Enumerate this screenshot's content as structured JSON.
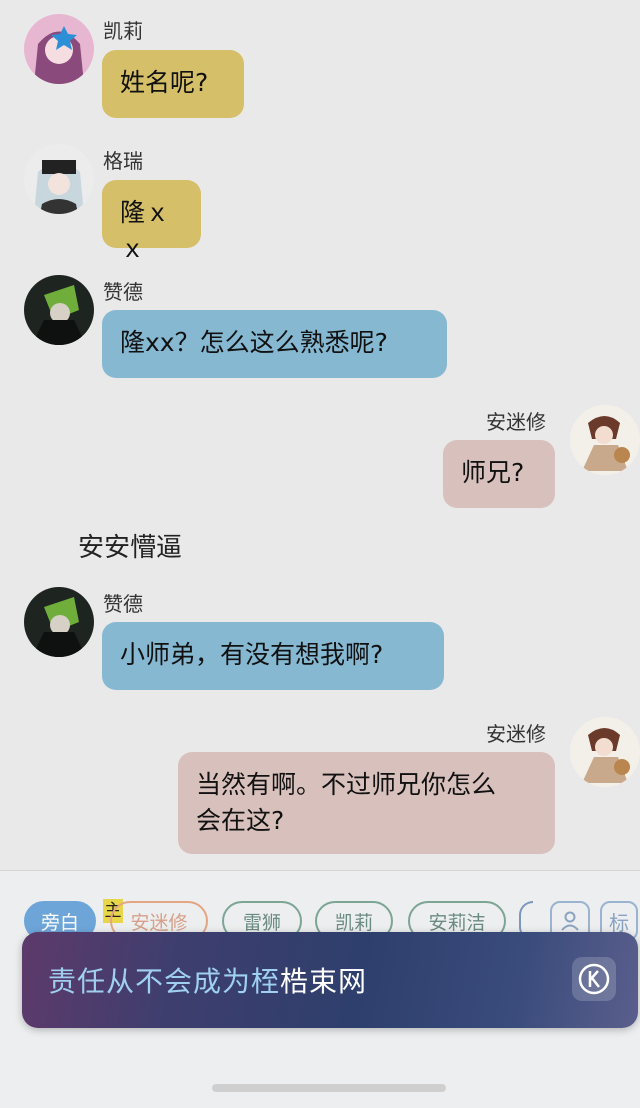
{
  "messages": [
    {
      "speaker": "凯莉",
      "text": "姓名呢?"
    },
    {
      "speaker": "格瑞",
      "text": "隆ｘｘ"
    },
    {
      "speaker": "赞德",
      "text": "隆xx？怎么这么熟悉呢?"
    },
    {
      "speaker": "安迷修",
      "text": "师兄?"
    },
    {
      "speaker": "赞德",
      "text": "小师弟，有没有想我啊?"
    },
    {
      "speaker": "安迷修",
      "text_line1": "当然有啊。不过师兄你怎么",
      "text_line2": "会在这?"
    }
  ],
  "narration": "安安懵逼",
  "character_bar": {
    "narrator": "旁白",
    "main_marker": "主",
    "chips": [
      "安迷修",
      "雷狮",
      "凯莉",
      "安莉洁"
    ],
    "person_icon": "person-icon",
    "tag_label": "标"
  },
  "banner": {
    "highlight": "责任从不会成为桎",
    "rest": "梏束网",
    "icon": "k-circle-icon"
  },
  "colors": {
    "yellow_bubble": "#d5bf68",
    "blue_bubble": "#86b8d2",
    "pink_bubble": "#d8c1bd",
    "active_chip": "#6ea5d8"
  }
}
